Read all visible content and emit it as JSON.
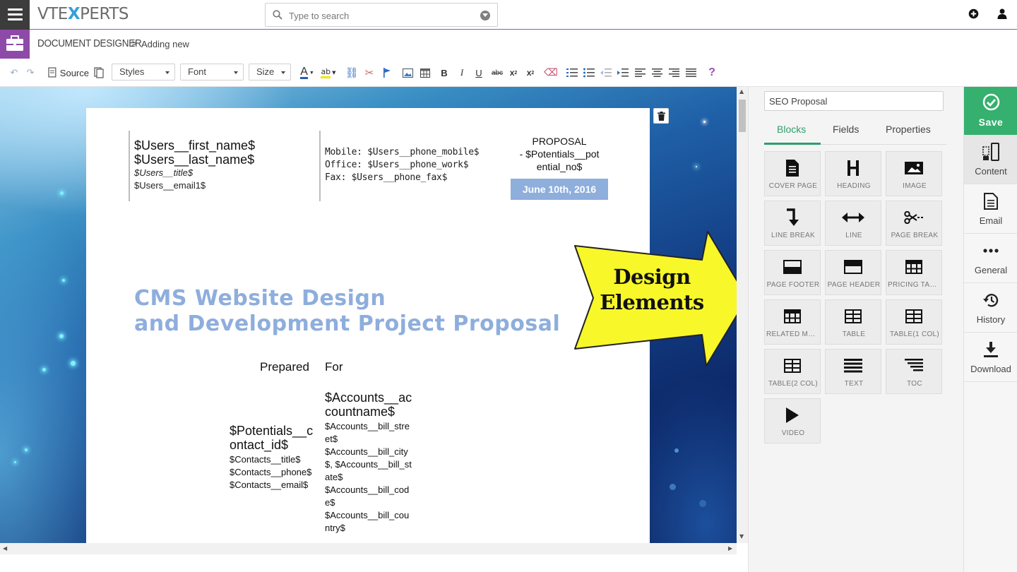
{
  "topbar": {
    "logo_left": "VTE",
    "logo_x": "X",
    "logo_right": "PERTS",
    "search_placeholder": "Type to search"
  },
  "breadcrumb": {
    "module": "DOCUMENT DESIGNER",
    "separator": ">",
    "page": "Adding new"
  },
  "toolbar": {
    "source_label": "Source",
    "styles_label": "Styles",
    "font_label": "Font",
    "size_label": "Size",
    "bold": "B",
    "italic": "I",
    "underline": "U",
    "strike": "abc",
    "subscript": "x",
    "sub_mark": "2",
    "superscript": "x",
    "sup_mark": "2",
    "text_color": "A",
    "help": "?"
  },
  "document": {
    "user_name_line1": "$Users__first_name$",
    "user_name_line2": "$Users__last_name$",
    "user_title": "$Users__title$",
    "user_email": "$Users__email1$",
    "mobile": "Mobile: $Users__phone_mobile$",
    "office": "Office: $Users__phone_work$",
    "fax": "Fax: $Users__phone_fax$",
    "proposal_heading": "PROPOSAL",
    "proposal_no_line1": "- $Potentials__pot",
    "proposal_no_line2": "ential_no$",
    "date": "June 10th, 2016",
    "title_line1": "CMS Website Design",
    "title_line2": "and Development Project Proposal",
    "prepared": "Prepared",
    "for": "For",
    "account_name": "$Accounts__accountname$",
    "bill_street": "$Accounts__bill_street$",
    "bill_city": "$Accounts__bill_city$, $Accounts__bill_state$",
    "bill_code": "$Accounts__bill_code$",
    "bill_country": "$Accounts__bill_country$",
    "contact_id": "$Potentials__contact_id$",
    "contact_title": "$Contacts__title$",
    "contact_phone": "$Contacts__phone$",
    "contact_email": "$Contacts__email$"
  },
  "callout": {
    "line1": "Design",
    "line2": "Elements",
    "color": "#f7f72a"
  },
  "panel": {
    "template_name": "SEO Proposal",
    "tabs": [
      "Blocks",
      "Fields",
      "Properties"
    ],
    "blocks": [
      {
        "label": "COVER PAGE",
        "icon": "document-icon"
      },
      {
        "label": "HEADING",
        "icon": "heading-icon"
      },
      {
        "label": "IMAGE",
        "icon": "image-icon"
      },
      {
        "label": "LINE BREAK",
        "icon": "line-break-icon"
      },
      {
        "label": "LINE",
        "icon": "double-arrow-icon"
      },
      {
        "label": "PAGE BREAK",
        "icon": "scissors-icon"
      },
      {
        "label": "PAGE FOOTER",
        "icon": "page-footer-icon"
      },
      {
        "label": "PAGE HEADER",
        "icon": "page-header-icon"
      },
      {
        "label": "PRICING TABLE",
        "icon": "pricing-table-icon"
      },
      {
        "label": "RELATED MODULE",
        "icon": "related-table-icon"
      },
      {
        "label": "TABLE",
        "icon": "table-icon"
      },
      {
        "label": "TABLE(1 COL)",
        "icon": "table-1col-icon"
      },
      {
        "label": "TABLE(2 COL)",
        "icon": "table-2col-icon"
      },
      {
        "label": "TEXT",
        "icon": "text-lines-icon"
      },
      {
        "label": "TOC",
        "icon": "toc-icon"
      },
      {
        "label": "VIDEO",
        "icon": "play-icon"
      }
    ]
  },
  "sidebar": {
    "save": "Save",
    "items": [
      "Content",
      "Email",
      "General",
      "History",
      "Download"
    ]
  },
  "colors": {
    "accent_green": "#35b06e",
    "module_purple": "#8e4aa8",
    "title_blue": "#8eaedc"
  }
}
